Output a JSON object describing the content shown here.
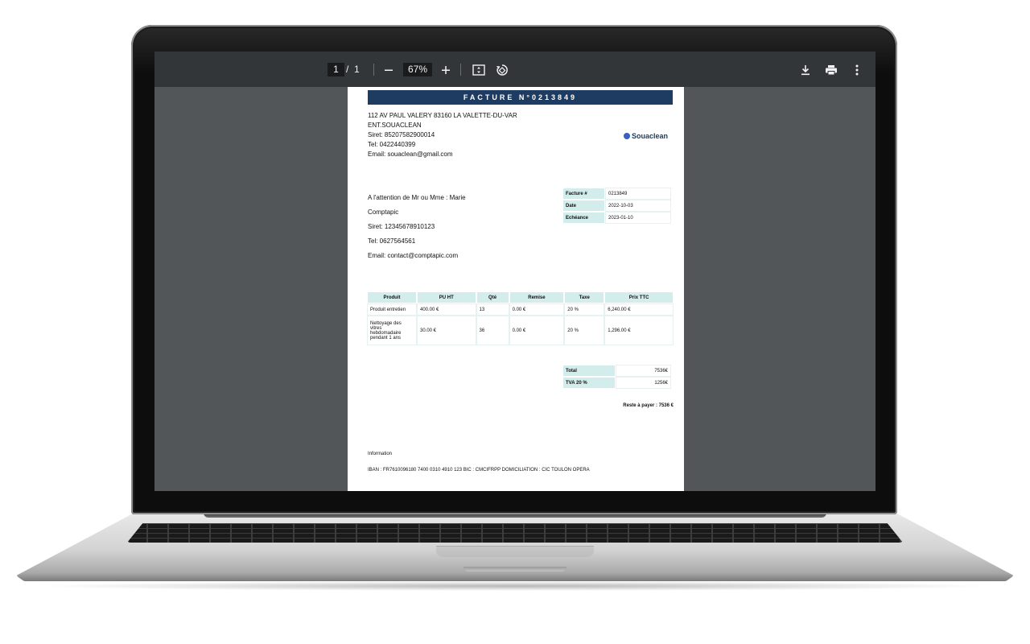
{
  "viewer": {
    "current_page": "1",
    "page_separator": "/",
    "total_pages": "1",
    "zoom": "67%"
  },
  "invoice": {
    "title": "FACTURE N°0213849",
    "sender": {
      "address": "112 AV PAUL VALERY 83160 LA VALETTE-DU-VAR",
      "company": "ENT.SOUACLEAN",
      "siret": "Siret: 85207582900014",
      "tel": "Tel: 0422440399",
      "email": "Email: souaclean@gmail.com"
    },
    "logo_text": "Souaclean",
    "client": {
      "attention": "A l'attention de Mr ou Mme : Marie",
      "company": "Comptapic",
      "siret": "Siret: 12345678910123",
      "tel": "Tel: 0627564561",
      "email": "Email: contact@comptapic.com"
    },
    "meta": [
      {
        "label": "Facture #",
        "value": "0213849"
      },
      {
        "label": "Date",
        "value": "2022-10-03"
      },
      {
        "label": "Echéance",
        "value": "2023-01-10"
      }
    ],
    "columns": [
      "Produit",
      "PU HT",
      "Qté",
      "Remise",
      "Taxe",
      "Prix TTC"
    ],
    "rows": [
      [
        "Produit entretien",
        "400.00 €",
        "13",
        "0.00 €",
        "20 %",
        "6,240.00 €"
      ],
      [
        "Nettoyage des vitres hebdomadaire pendant 1 ans",
        "30.00 €",
        "36",
        "0.00 €",
        "20 %",
        "1,296.00 €"
      ]
    ],
    "totals": [
      {
        "label": "Total",
        "value": "7536€"
      },
      {
        "label": "TVA 20 %",
        "value": "1256€"
      }
    ],
    "reste": "Reste à payer : 7536 €",
    "info_label": "Information",
    "iban": "IBAN : FR7610096180 7400 0310 4910 123 BIC : CMCIFRPP DOMICILIATION : CIC TOULON OPERA"
  },
  "colors": {
    "title_bar": "#1e3b62",
    "table_header": "#d3ecec",
    "viewer_bg": "#525659",
    "toolbar_bg": "#323639"
  },
  "icons": [
    "zoom-out-icon",
    "zoom-in-icon",
    "fit-page-icon",
    "rotate-icon",
    "download-icon",
    "print-icon",
    "more-vert-icon"
  ]
}
